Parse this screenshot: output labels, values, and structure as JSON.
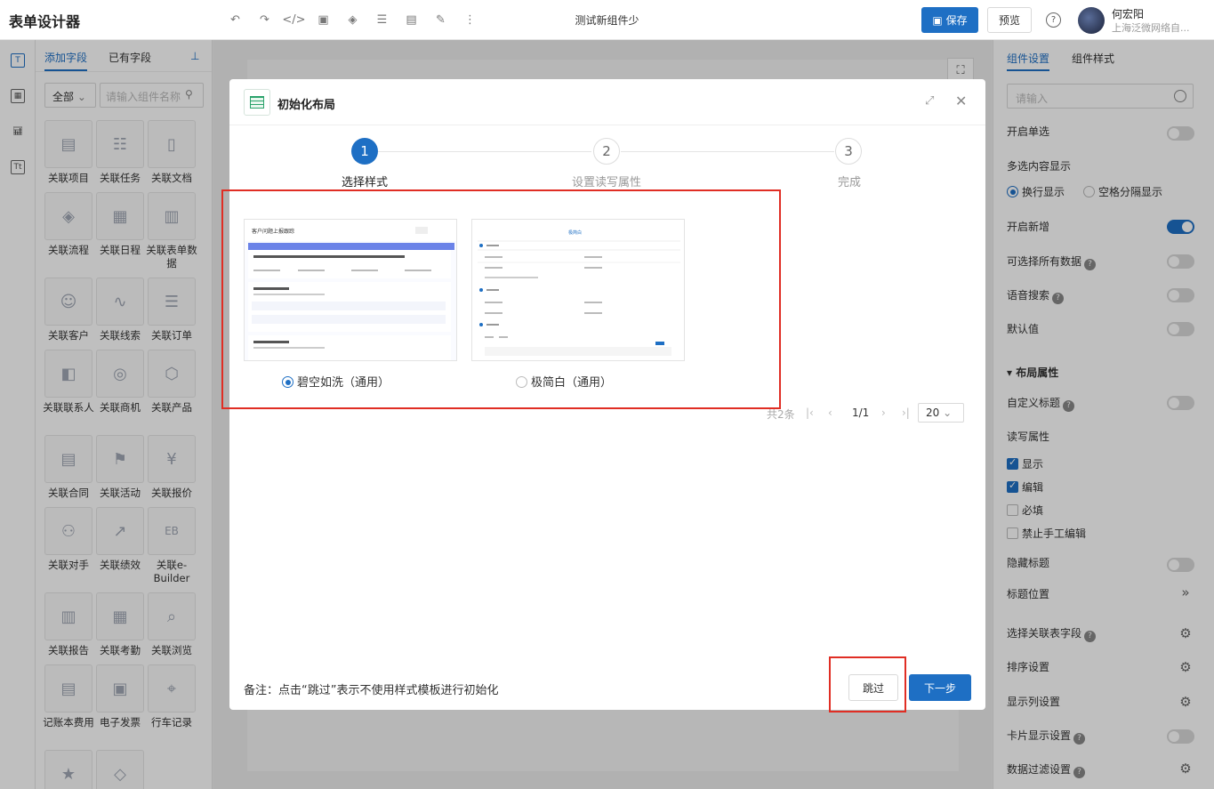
{
  "app": {
    "title": "表单设计器",
    "doc_title": "测试新组件少"
  },
  "toolbar": {
    "save_label": "保存",
    "preview_label": "预览",
    "help_label": "?"
  },
  "user": {
    "name": "何宏阳",
    "org": "上海泛微网络自..."
  },
  "left_panel": {
    "tabs": [
      "添加字段",
      "已有字段"
    ],
    "filter_value": "全部",
    "search_placeholder": "请输入组件名称",
    "fields": [
      "关联项目",
      "关联任务",
      "关联文档",
      "关联流程",
      "关联日程",
      "关联表单数据",
      "关联客户",
      "关联线索",
      "关联订单",
      "关联联系人",
      "关联商机",
      "关联产品",
      "关联合同",
      "关联活动",
      "关联报价",
      "关联对手",
      "关联绩效",
      "关联e-Builder",
      "关联报告",
      "关联考勤",
      "关联浏览",
      "记账本费用",
      "电子发票",
      "行车记录",
      "",
      ""
    ]
  },
  "right_panel": {
    "tabs": [
      "组件设置",
      "组件样式"
    ],
    "input_placeholder": "请输入",
    "rows": {
      "open_single": "开启单选",
      "multi_display": "多选内容显示",
      "opt_newline": "换行显示",
      "opt_space": "空格分隔显示",
      "open_add": "开启新增",
      "select_all": "可选择所有数据",
      "voice_search": "语音搜索",
      "default_value": "默认值",
      "layout_section": "▾ 布局属性",
      "custom_title": "自定义标题",
      "rw_attr": "读写属性",
      "cb_show": "显示",
      "cb_edit": "编辑",
      "cb_required": "必填",
      "cb_noedit": "禁止手工编辑",
      "hide_title": "隐藏标题",
      "title_pos": "标题位置",
      "select_fields": "选择关联表字段",
      "sort": "排序设置",
      "display_cols": "显示列设置",
      "card_display": "卡片显示设置",
      "data_filter": "数据过滤设置"
    }
  },
  "modal": {
    "title": "初始化布局",
    "steps": [
      {
        "num": "1",
        "label": "选择样式"
      },
      {
        "num": "2",
        "label": "设置读写属性"
      },
      {
        "num": "3",
        "label": "完成"
      }
    ],
    "styles": [
      {
        "label": "碧空如洗（通用）",
        "selected": true,
        "preview_title": "客户问题上报跟踪"
      },
      {
        "label": "极简白（通用）",
        "selected": false,
        "preview_title": "极简白"
      }
    ],
    "pager": {
      "total": "共2条",
      "page": "1/1",
      "page_size": "20"
    },
    "note": "备注：点击“跳过”表示不使用样式模板进行初始化",
    "skip_label": "跳过",
    "next_label": "下一步"
  },
  "colors": {
    "accent": "#1e6fc4",
    "highlight": "#e02e24",
    "toggle_off": "#d9d9d9"
  }
}
